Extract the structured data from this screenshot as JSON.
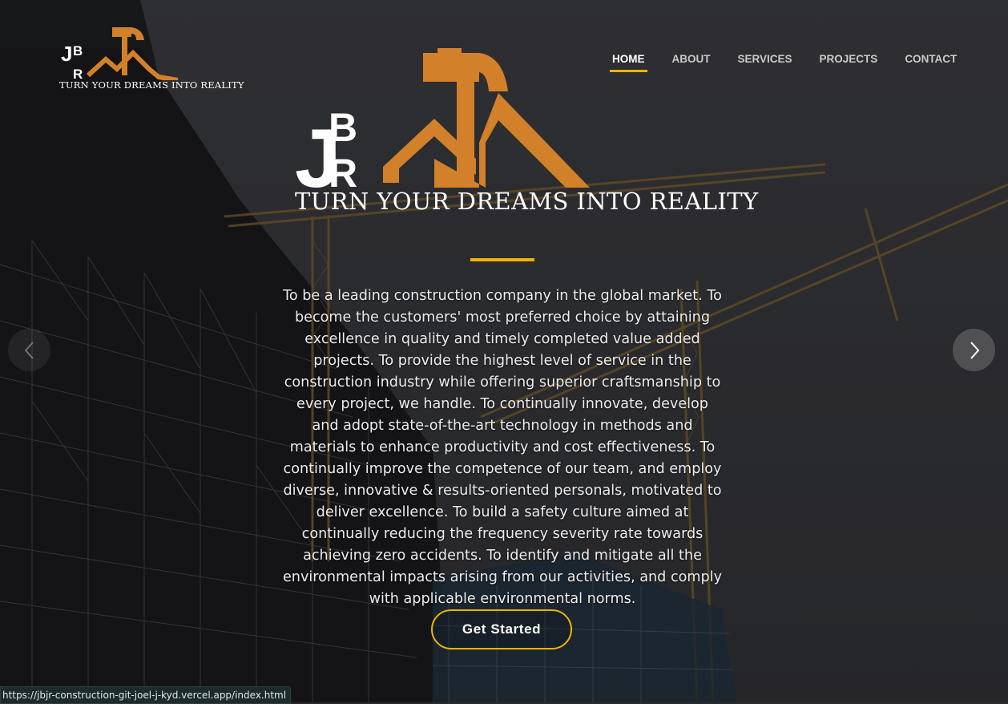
{
  "brand": {
    "logo_letters": "JBJR",
    "tagline": "TURN YOUR DREAMS INTO REALITY",
    "accent_color": "#D2802A",
    "highlight_color": "#F0B400"
  },
  "nav": {
    "items": [
      {
        "label": "HOME",
        "active": true
      },
      {
        "label": "ABOUT",
        "active": false
      },
      {
        "label": "SERVICES",
        "active": false
      },
      {
        "label": "PROJECTS",
        "active": false
      },
      {
        "label": "CONTACT",
        "active": false
      }
    ]
  },
  "hero": {
    "mission": "To be a leading construction company in the global market. To become the customers' most preferred choice by attaining excellence in quality and timely completed value added projects. To provide the highest level of service in the construction industry while offering superior craftsmanship to every project, we handle. To continually innovate, develop and adopt state-of-the-art technology in methods and materials to enhance productivity and cost effectiveness. To continually improve the competence of our team, and employ diverse, innovative & results-oriented personals, motivated to deliver excellence. To build a safety culture aimed at continually reducing the frequency severity rate towards achieving zero accidents. To identify and mitigate all the environmental impacts arising from our activities, and comply with applicable environmental norms.",
    "cta_label": "Get Started",
    "prev_icon": "chevron-left-icon",
    "next_icon": "chevron-right-icon"
  },
  "status_bar": {
    "url": "https://jbjr-construction-git-joel-j-kyd.vercel.app/index.html"
  }
}
